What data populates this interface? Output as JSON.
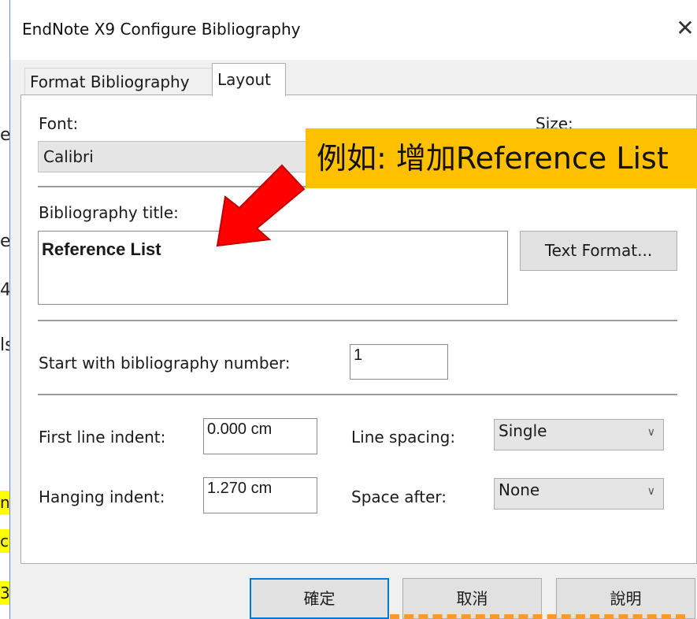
{
  "background_doc": {
    "letters": [
      "e",
      "e",
      "4",
      "ls"
    ],
    "highlighted_letters": [
      "n",
      "c",
      "3"
    ]
  },
  "dialog": {
    "title": "EndNote X9 Configure Bibliography",
    "close_glyph": "✕",
    "tabs": [
      {
        "label": "Format Bibliography",
        "active": false
      },
      {
        "label": "Layout",
        "active": true
      }
    ],
    "font": {
      "label": "Font:",
      "value": "Calibri"
    },
    "size": {
      "label": "Size:"
    },
    "bibliography_title": {
      "label": "Bibliography title:",
      "value": "Reference List"
    },
    "text_format_button": "Text Format...",
    "start_number": {
      "label": "Start with bibliography number:",
      "value": "1"
    },
    "first_line_indent": {
      "label": "First line indent:",
      "value": "0.000 cm"
    },
    "hanging_indent": {
      "label": "Hanging indent:",
      "value": "1.270 cm"
    },
    "line_spacing": {
      "label": "Line spacing:",
      "value": "Single"
    },
    "space_after": {
      "label": "Space after:",
      "value": "None"
    },
    "buttons": {
      "ok": "確定",
      "cancel": "取消",
      "help": "說明"
    }
  },
  "annotation": {
    "callout_text": "例如: 增加Reference List",
    "arrow_color": "#ff0000",
    "callout_color": "#ffc000"
  },
  "colors": {
    "accent": "#0078d7",
    "highlight": "#ffff00"
  }
}
